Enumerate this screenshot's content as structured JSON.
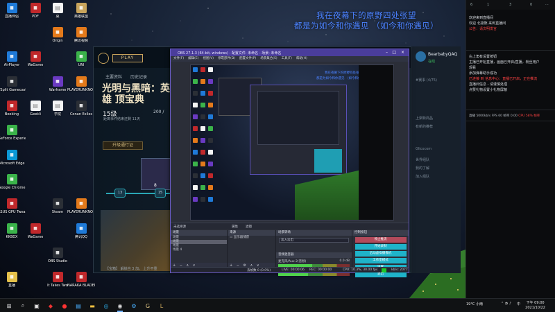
{
  "desktop": {
    "caption_line1": "我在夜幕下的原野四处张望",
    "caption_line2": "都是为如今和你遇见 （如今和你遇见）",
    "icons": [
      {
        "label": "直播伴侣",
        "icon": "app-icon",
        "color": "#1f7ad8"
      },
      {
        "label": "PDF",
        "icon": "pdf-icon",
        "color": "#c0282b"
      },
      {
        "label": "桌",
        "icon": "file-icon",
        "color": "#f4f4f4"
      },
      {
        "label": "英雄联盟",
        "icon": "game-icon",
        "color": "#c8a45c"
      },
      {
        "label": "腾讯视频",
        "icon": "video-icon",
        "color": "#e47a1b"
      },
      {
        "label": "Origin",
        "icon": "origin-icon",
        "color": "#e47a1b"
      },
      {
        "label": "UNI",
        "icon": "chat-icon",
        "color": "#3bb34a"
      },
      {
        "label": "AirPlayer",
        "icon": "airplay-icon",
        "color": "#1f7ad8"
      },
      {
        "label": "WeGame",
        "icon": "wegame-icon",
        "color": "#c0282b"
      },
      {
        "label": "PLAYERUNKNOWN'S",
        "icon": "game-icon",
        "color": "#e47a1b"
      },
      {
        "label": "VSplit Gamecaster",
        "icon": "record-icon",
        "color": "#2b2f36"
      },
      {
        "label": "Warframe",
        "icon": "game-icon",
        "color": "#6a3ac2"
      },
      {
        "label": "Conan Exiles",
        "icon": "game-icon",
        "color": "#2b2f36"
      },
      {
        "label": "Booking",
        "icon": "booking-icon",
        "color": "#c0282b"
      },
      {
        "label": "Geekli",
        "icon": "file-icon",
        "color": "#f4f4f4"
      },
      {
        "label": "学院",
        "icon": "file-icon",
        "color": "#f4f4f4"
      },
      {
        "label": "GeForce Experience",
        "icon": "nvidia-icon",
        "color": "#3bb34a"
      },
      {
        "label": "Microsoft Edge",
        "icon": "edge-icon",
        "color": "#0b98d6"
      },
      {
        "label": "Google Chrome",
        "icon": "chrome-icon",
        "color": "#3bb34a"
      },
      {
        "label": "ASUS GPU Tweak II",
        "icon": "gpu-icon",
        "color": "#c0282b"
      },
      {
        "label": "Steam",
        "icon": "steam-icon",
        "color": "#2b2f36"
      },
      {
        "label": "PLAYERUNKNOWN'S",
        "icon": "game-icon",
        "color": "#e47a1b"
      },
      {
        "label": "KKBOX",
        "icon": "music-icon",
        "color": "#3bb34a"
      },
      {
        "label": "WeGame",
        "icon": "wegame-icon",
        "color": "#c0282b"
      },
      {
        "label": "腾讯QQ",
        "icon": "qq-icon",
        "color": "#1f7ad8"
      },
      {
        "label": "OBS Studio",
        "icon": "obs-icon",
        "color": "#2b2f36"
      },
      {
        "label": "It Takes Two",
        "icon": "game-icon",
        "color": "#c0282b"
      },
      {
        "label": "NARAKA BLADEPOINT",
        "icon": "game-icon",
        "color": "#c0282b"
      },
      {
        "label": "直播",
        "icon": "folder-icon",
        "color": "#e4c04a"
      }
    ]
  },
  "launcher": {
    "play": "PLAY",
    "tabs": [
      "主要资料",
      "历史记录"
    ],
    "title": "光明与黑暗：英雄 顶宝典",
    "subtitle": "距离事件结束还剩 11天",
    "level": "15级",
    "progress": "200 /",
    "upgrade": "升级通行证",
    "node_a": "13",
    "node_b": "15",
    "card_count": "8",
    "note": "【宝箱】 解锁自 3 加。 上升不重"
  },
  "chat_panel": {
    "name": "BearbabyQAQ",
    "status": "在线",
    "lines": [
      "#赛事 (4/75)",
      "上架新商品",
      "有新的推荐",
      "Glicocom",
      "世界组队",
      "我的了解",
      "加入组队"
    ]
  },
  "live_chat": {
    "top": [
      "6",
      "1",
      "3",
      "0"
    ],
    "messages": [
      {
        "text": "欢迎来到直播间",
        "highlight": false
      },
      {
        "text": "欢迎 北极熊 来到直播间",
        "highlight": false
      },
      {
        "text": "公告：请文明发言",
        "highlight": true
      }
    ],
    "notices": [
      {
        "text": "右上角有设置按钮",
        "highlight": false
      },
      {
        "text": "主播已开始直播，画面已开启/直播，粉丝用户",
        "highlight": false
      },
      {
        "text": "观看",
        "highlight": false
      },
      {
        "text": "添加弹幕助手成功",
        "highlight": false
      },
      {
        "text": "已连接 到 信息中心：直播已开启，正在推流",
        "highlight": true
      },
      {
        "text": "直播间信息 - 请谨慎处理",
        "highlight": false
      },
      {
        "text": "点赞礼物设置小礼物屏蔽",
        "highlight": false
      }
    ],
    "stats_label": "直播",
    "stats": "5000kb/s  FPS 60  帧率 0.00",
    "stats_warn": "CPU 58%  帧率"
  },
  "obs": {
    "title": "OBS 27.1.3 (64-bit, windows) - 配置文件: 未命名 - 场景: 未命名",
    "menu": [
      "文件(F)",
      "编辑(E)",
      "视图(V)",
      "停靠部件(D)",
      "配置文件(P)",
      "场景集合(S)",
      "工具(T)",
      "帮助(H)"
    ],
    "strip_label": "未选择源",
    "strip_buttons": [
      "属性",
      "滤镜"
    ],
    "scenes": {
      "header": "场景",
      "items": [
        {
          "label": "场景",
          "selected": false
        },
        {
          "label": "场景",
          "selected": true
        },
        {
          "label": "场景",
          "selected": false
        },
        {
          "label": "场景 4",
          "selected": false
        }
      ]
    },
    "sources": {
      "header": "来源",
      "items": [
        "显示器捕获"
      ]
    },
    "mixer": {
      "header": "音频混音器",
      "channels": [
        {
          "name": "麦克风/Aux 2(音频)",
          "level": 0.48,
          "db": "0.0 dB"
        },
        {
          "name": "麦克风/Aux 1",
          "level": 0.42,
          "db": "0.0 dB"
        }
      ]
    },
    "transitions": {
      "header": "场景转场",
      "value": "淡入淡出"
    },
    "controls": {
      "header": "控制按钮",
      "buttons": [
        {
          "label": "停止推流",
          "active": true
        },
        {
          "label": "开始录制",
          "active": false
        },
        {
          "label": "启动虚拟摄像机",
          "active": false
        },
        {
          "label": "工作室模式",
          "active": false
        },
        {
          "label": "设置",
          "active": false
        },
        {
          "label": "退出",
          "active": false
        }
      ]
    },
    "status": {
      "dropped": "丢帧数 0 (0.0%)",
      "live": "LIVE: 00:00:06",
      "rec": "REC: 00:00:00",
      "cpu": "CPU: 10.3%, 30.00 fps",
      "kbps": "kb/s: 2077"
    }
  },
  "taskbar": {
    "weather": "19°C  小雨",
    "lang": "中",
    "time": "下午 09:00",
    "date": "2021/10/22"
  }
}
